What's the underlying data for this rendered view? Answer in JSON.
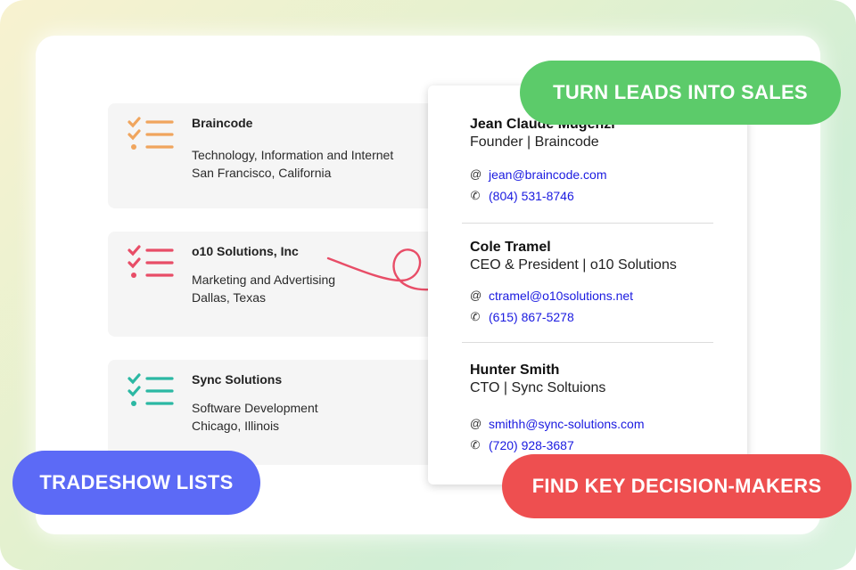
{
  "companies": [
    {
      "name": "Braincode",
      "industry": "Technology, Information and Internet",
      "location": "San Francisco, California",
      "icon": "checklist-icon",
      "color": "#f0a55d"
    },
    {
      "name": "o10 Solutions, Inc",
      "industry": "Marketing and Advertising",
      "location": "Dallas, Texas",
      "icon": "checklist-icon",
      "color": "#e84d67"
    },
    {
      "name": "Sync Solutions",
      "industry": "Software Development",
      "location": "Chicago, Illinois",
      "icon": "checklist-icon",
      "color": "#2bb8a3"
    }
  ],
  "contacts": [
    {
      "name": "Jean Claude Mugenzi",
      "title": "Founder | Braincode",
      "email": "jean@braincode.com",
      "phone": "(804) 531-8746"
    },
    {
      "name": "Cole Tramel",
      "title": "CEO & President | o10 Solutions",
      "email": "ctramel@o10solutions.net",
      "phone": "(615) 867-5278"
    },
    {
      "name": "Hunter Smith",
      "title": "CTO | Sync Soltuions",
      "email": "smithh@sync-solutions.com",
      "phone": "(720) 928-3687"
    }
  ],
  "banners": {
    "top": "TURN LEADS INTO SALES",
    "left": "TRADESHOW LISTS",
    "right": "FIND KEY DECISION-MAKERS"
  },
  "colors": {
    "green": "#5ccb6a",
    "blue": "#5c6af6",
    "red": "#ee4f50",
    "link": "#1a1ae0",
    "arrow": "#e84d67"
  }
}
